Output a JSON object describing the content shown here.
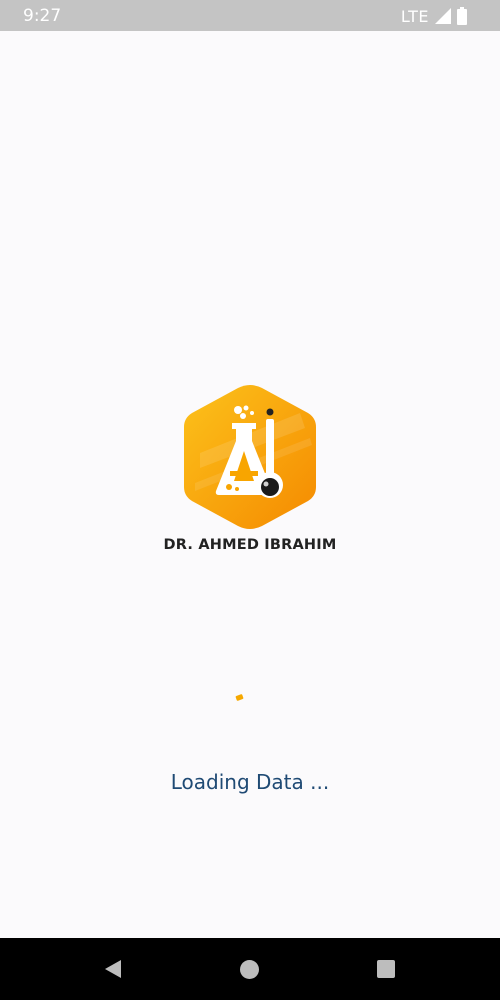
{
  "status_bar": {
    "time": "9:27",
    "network": "LTE",
    "color": "#ffffff",
    "background": "#c4c4c4"
  },
  "logo": {
    "name": "DR. AHMED IBRAHIM",
    "icon": "chemistry-flask-logo",
    "colors": {
      "primary": "#f9b100",
      "secondary": "#f58a00"
    }
  },
  "loading": {
    "text": "Loading Data ...",
    "spinner_color": "#f6a800",
    "text_color": "#1f4a74"
  },
  "nav_bar": {
    "buttons": [
      "back",
      "home",
      "recents"
    ]
  }
}
